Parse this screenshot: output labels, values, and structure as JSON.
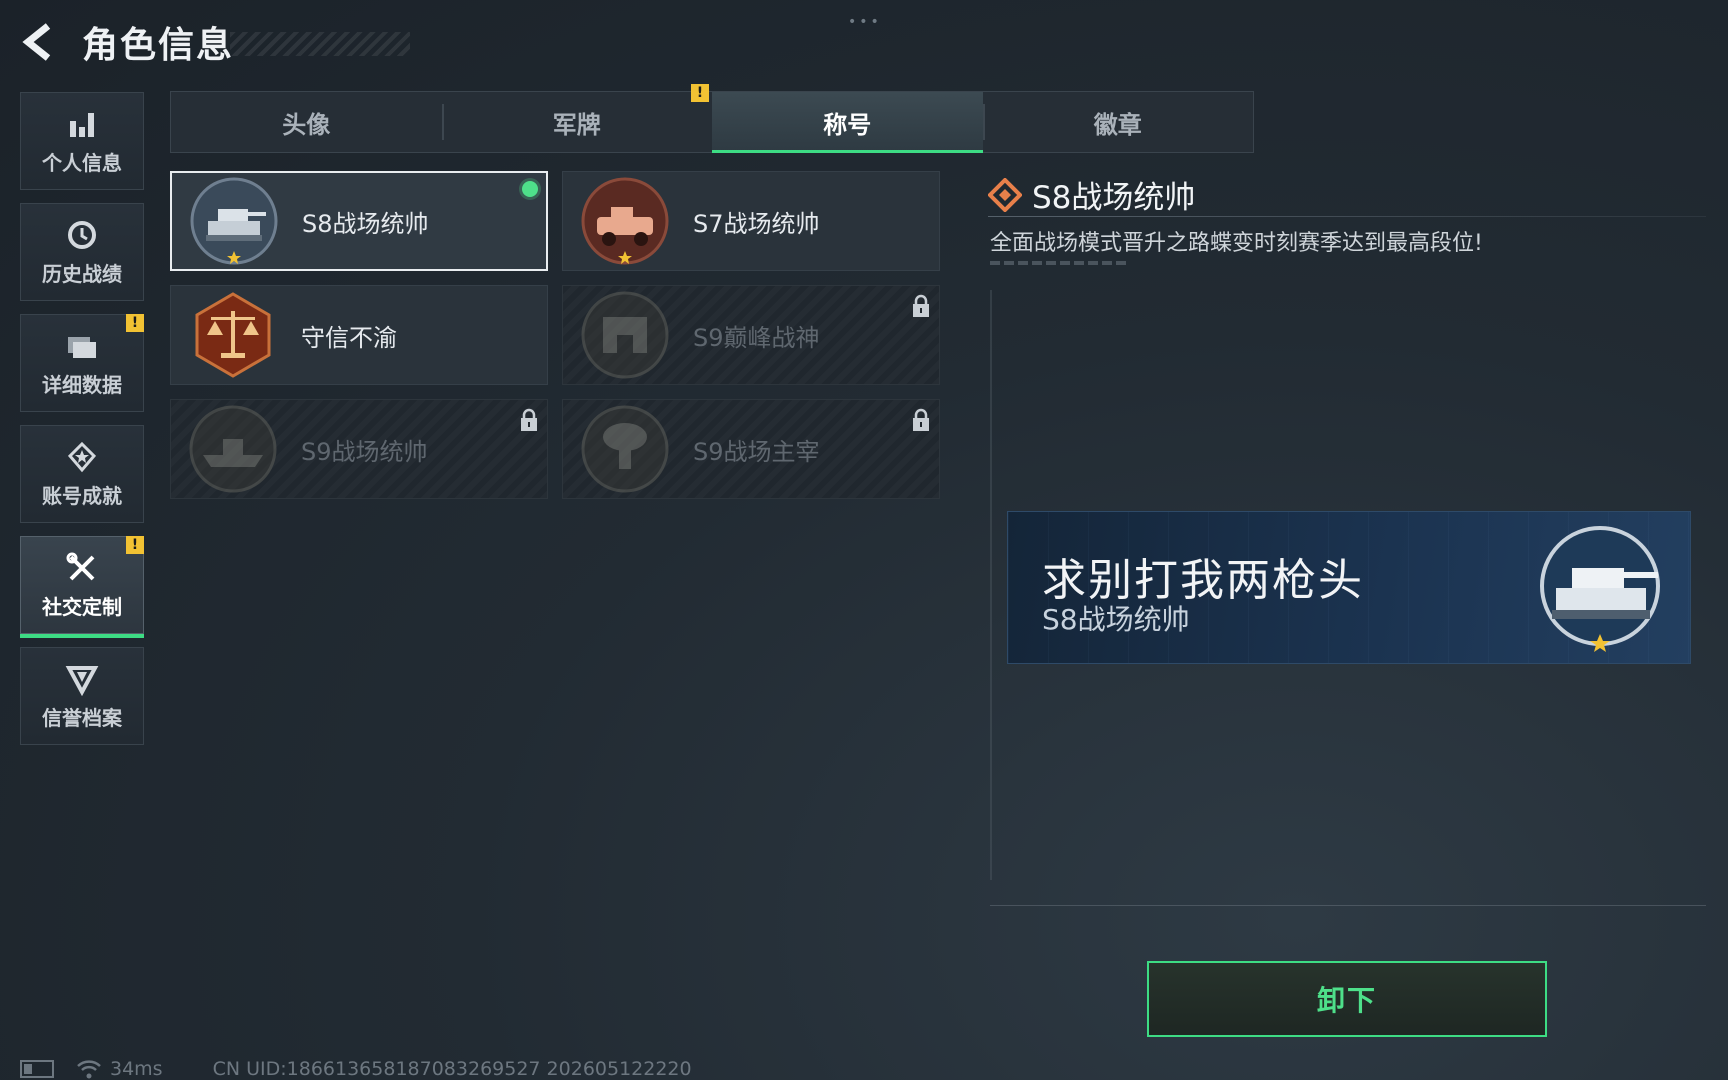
{
  "header": {
    "title": "角色信息"
  },
  "sidebar": {
    "items": [
      {
        "label": "个人信息",
        "icon": "bar-chart-icon",
        "alert": ""
      },
      {
        "label": "历史战绩",
        "icon": "history-icon",
        "alert": ""
      },
      {
        "label": "详细数据",
        "icon": "folder-icon",
        "alert": "!"
      },
      {
        "label": "账号成就",
        "icon": "achievement-icon",
        "alert": ""
      },
      {
        "label": "社交定制",
        "icon": "tools-icon",
        "alert": "!"
      },
      {
        "label": "信誉档案",
        "icon": "shield-icon",
        "alert": ""
      }
    ],
    "active": "社交定制"
  },
  "tabs": {
    "items": [
      {
        "label": "头像"
      },
      {
        "label": "军牌"
      },
      {
        "label": "称号"
      },
      {
        "label": "徽章"
      }
    ],
    "active": "称号",
    "alert": "!"
  },
  "titles": [
    {
      "name": "S8战场统帅",
      "state": "equipped",
      "emblem": "tank-emblem-icon"
    },
    {
      "name": "S7战场统帅",
      "state": "unlocked",
      "emblem": "armored-car-emblem-icon"
    },
    {
      "name": "守信不渝",
      "state": "unlocked",
      "emblem": "justice-scale-emblem-icon"
    },
    {
      "name": "S9巅峰战神",
      "state": "locked",
      "emblem": "fortress-emblem-icon"
    },
    {
      "name": "S9战场统帅",
      "state": "locked",
      "emblem": "warship-emblem-icon"
    },
    {
      "name": "S9战场主宰",
      "state": "locked",
      "emblem": "mushroom-cloud-emblem-icon"
    }
  ],
  "detail": {
    "title": "S8战场统帅",
    "description": "全面战场模式晋升之路蝶变时刻赛季达到最高段位!"
  },
  "banner": {
    "player_name": "求别打我两枪头",
    "title": "S8战场统帅"
  },
  "actions": {
    "unequip_label": "卸下"
  },
  "status": {
    "ping": "34ms",
    "uid": "CN UID:1866136581870832695​27 202605122220"
  },
  "colors": {
    "accent": "#3ddc84",
    "alert": "#f2c233",
    "background": "#222b33",
    "banner": "#1b3350"
  }
}
